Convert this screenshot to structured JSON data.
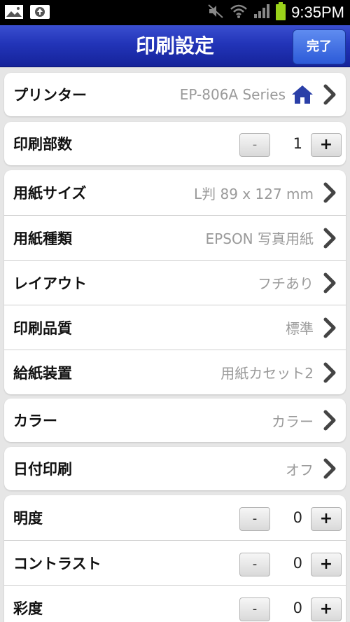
{
  "status_bar": {
    "time": "9:35PM",
    "icons": [
      "image-icon",
      "upload-icon",
      "mute-icon",
      "wifi-icon",
      "signal-icon",
      "battery-icon"
    ]
  },
  "header": {
    "title": "印刷設定",
    "done_label": "完了"
  },
  "printer": {
    "label": "プリンター",
    "value": "EP-806A Series"
  },
  "copies": {
    "label": "印刷部数",
    "value": "1",
    "minus": "-",
    "plus": "+"
  },
  "paper": {
    "size": {
      "label": "用紙サイズ",
      "value": "L判 89 x 127 mm"
    },
    "type": {
      "label": "用紙種類",
      "value": "EPSON 写真用紙"
    },
    "layout": {
      "label": "レイアウト",
      "value": "フチあり"
    },
    "quality": {
      "label": "印刷品質",
      "value": "標準"
    },
    "source": {
      "label": "給紙装置",
      "value": "用紙カセット2"
    }
  },
  "color": {
    "label": "カラー",
    "value": "カラー"
  },
  "date": {
    "label": "日付印刷",
    "value": "オフ"
  },
  "adjust": {
    "brightness": {
      "label": "明度",
      "value": "0",
      "minus": "-",
      "plus": "+"
    },
    "contrast": {
      "label": "コントラスト",
      "value": "0",
      "minus": "-",
      "plus": "+"
    },
    "saturation": {
      "label": "彩度",
      "value": "0",
      "minus": "-",
      "plus": "+"
    }
  },
  "colors": {
    "title_bar": "#2234b8",
    "accent_button": "#3d6fe0",
    "value_text": "#9a9a9a",
    "home_icon": "#2a3fa8"
  }
}
